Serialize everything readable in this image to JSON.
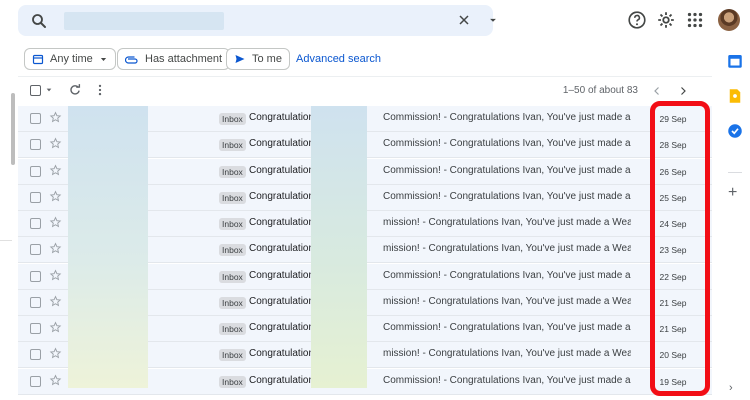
{
  "search": {
    "value": "",
    "placeholder": ""
  },
  "filters": {
    "any_time": "Any time",
    "has_attachment": "Has attachment",
    "to_me": "To me",
    "advanced_search": "Advanced search"
  },
  "toolbar": {
    "pager_text": "1–50 of about 83"
  },
  "emails": [
    {
      "tag": "Inbox",
      "subject_start": "Congratulations! A",
      "subject_end": "Commission! - Congratulations Ivan, You've just made a...",
      "date": "29 Sep"
    },
    {
      "tag": "Inbox",
      "subject_start": "Congratulations! A",
      "subject_end": "Commission! - Congratulations Ivan, You've just made a...",
      "date": "28 Sep"
    },
    {
      "tag": "Inbox",
      "subject_start": "Congratulations! A",
      "subject_end": "Commission! - Congratulations Ivan, You've just made a...",
      "date": "26 Sep"
    },
    {
      "tag": "Inbox",
      "subject_start": "Congratulations! A",
      "subject_end": "Commission! - Congratulations Ivan, You've just made a...",
      "date": "25 Sep"
    },
    {
      "tag": "Inbox",
      "subject_start": "Congratulations! A",
      "subject_end": "mission! - Congratulations Ivan, You've just made a Wea...",
      "date": "24 Sep"
    },
    {
      "tag": "Inbox",
      "subject_start": "Congratulations! A",
      "subject_end": "mission! - Congratulations Ivan, You've just made a Wea...",
      "date": "23 Sep"
    },
    {
      "tag": "Inbox",
      "subject_start": "Congratulations! A",
      "subject_end": "Commission! - Congratulations Ivan, You've just made a...",
      "date": "22 Sep"
    },
    {
      "tag": "Inbox",
      "subject_start": "Congratulations! A",
      "subject_end": "mission! - Congratulations Ivan, You've just made a Wea...",
      "date": "21 Sep"
    },
    {
      "tag": "Inbox",
      "subject_start": "Congratulations! A",
      "subject_end": "Commission! - Congratulations Ivan, You've just made a...",
      "date": "21 Sep"
    },
    {
      "tag": "Inbox",
      "subject_start": "Congratulations! A",
      "subject_end": "mission! - Congratulations Ivan, You've just made a Wea...",
      "date": "20 Sep"
    },
    {
      "tag": "Inbox",
      "subject_start": "Congratulations! A",
      "subject_end": "Commission! - Congratulations Ivan, You've just made a...",
      "date": "19 Sep"
    }
  ],
  "icons": {
    "search": "search-icon",
    "clear": "close-icon",
    "options": "caret-down-icon",
    "help": "help-icon",
    "settings": "gear-icon",
    "apps": "apps-grid-icon",
    "calendar": "calendar-icon",
    "keep": "keep-icon",
    "tasks": "tasks-icon"
  },
  "colors": {
    "highlight": "#f20e16",
    "accent_link": "#0b57d0",
    "row_background": "#f2f6fc"
  }
}
